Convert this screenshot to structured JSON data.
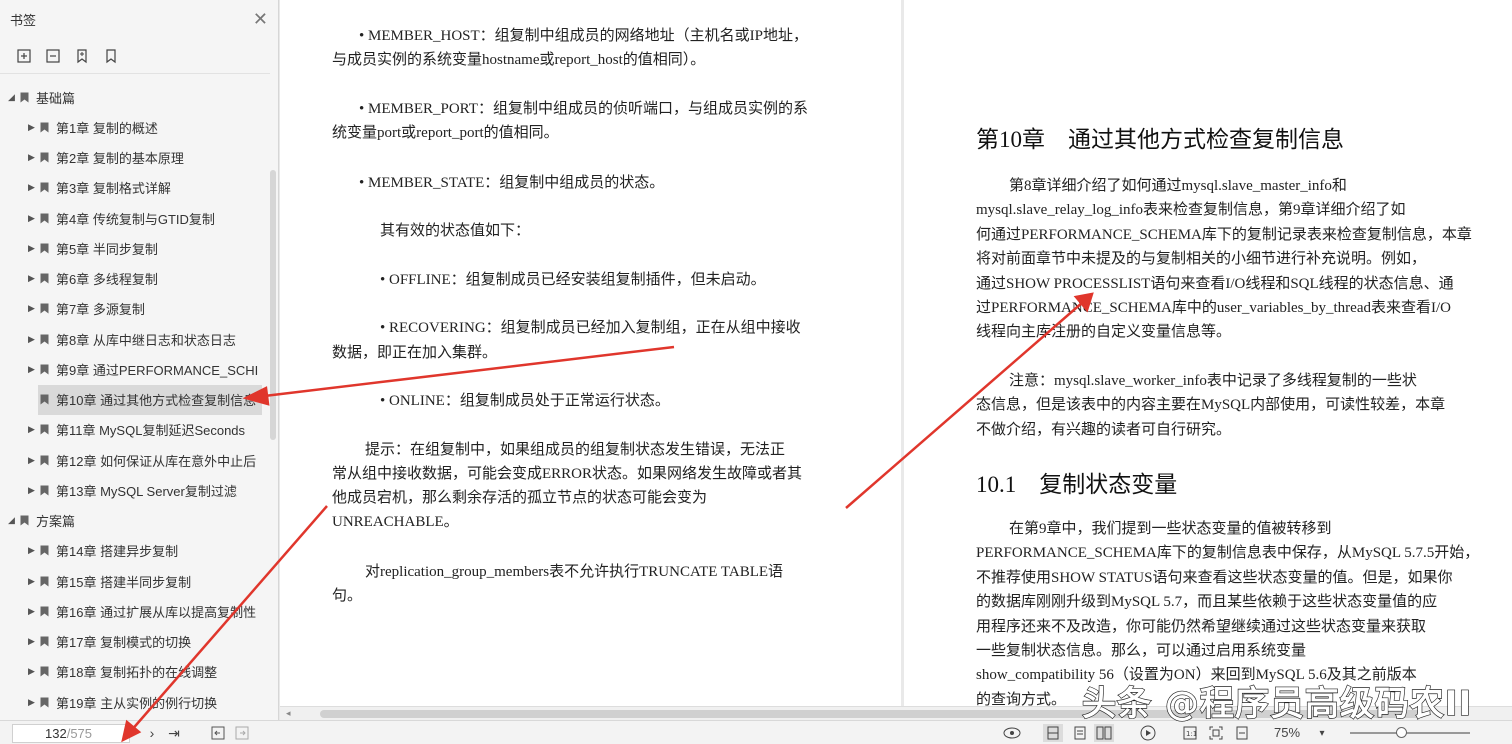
{
  "sidebar": {
    "title": "书签",
    "close_icon": "close-icon",
    "tools": [
      "expand-all-icon",
      "collapse-all-icon",
      "add-bookmark-icon",
      "bookmark-icon"
    ],
    "groups": [
      {
        "label": "基础篇",
        "items": [
          "第1章 复制的概述",
          "第2章 复制的基本原理",
          "第3章 复制格式详解",
          "第4章 传统复制与GTID复制",
          "第5章 半同步复制",
          "第6章 多线程复制",
          "第7章 多源复制",
          "第8章 从库中继日志和状态日志",
          "第9章 通过PERFORMANCE_SCHI",
          "第10章 通过其他方式检查复制信息",
          "第11章 MySQL复制延迟Seconds",
          "第12章 如何保证从库在意外中止后",
          "第13章 MySQL Server复制过滤"
        ]
      },
      {
        "label": "方案篇",
        "items": [
          "第14章 搭建异步复制",
          "第15章 搭建半同步复制",
          "第16章 通过扩展从库以提高复制性",
          "第17章 复制模式的切换",
          "第18章 复制拓扑的在线调整",
          "第19章 主从实例的例行切换"
        ]
      }
    ],
    "selected_item": "第10章 通过其他方式检查复制信息"
  },
  "left_page": {
    "paragraphs": [
      "• MEMBER_HOST：组复制中组成员的网络地址（主机名或IP地址，",
      "与成员实例的系统变量hostname或report_host的值相同）。",
      "• MEMBER_PORT：组复制中组成员的侦听端口，与组成员实例的系",
      "统变量port或report_port的值相同。",
      "• MEMBER_STATE：组复制中组成员的状态。",
      "其有效的状态值如下：",
      "• OFFLINE：组复制成员已经安装组复制插件，但未启动。",
      "• RECOVERING：组复制成员已经加入复制组，正在从组中接收",
      "数据，即正在加入集群。",
      "• ONLINE：组复制成员处于正常运行状态。",
      "提示：在组复制中，如果组成员的组复制状态发生错误，无法正",
      "常从组中接收数据，可能会变成ERROR状态。如果网络发生故障或者其",
      "他成员宕机，那么剩余存活的孤立节点的状态可能会变为",
      "UNREACHABLE。",
      "对replication_group_members表不允许执行TRUNCATE TABLE语",
      "句。"
    ]
  },
  "right_page": {
    "chapter_title": "第10章　通过其他方式检查复制信息",
    "intro": [
      "第8章详细介绍了如何通过mysql.slave_master_info和",
      "mysql.slave_relay_log_info表来检查复制信息，第9章详细介绍了如",
      "何通过PERFORMANCE_SCHEMA库下的复制记录表来检查复制信息，本章",
      "将对前面章节中未提及的与复制相关的小细节进行补充说明。例如，",
      "通过SHOW PROCESSLIST语句来查看I/O线程和SQL线程的状态信息、通",
      "过PERFORMANCE_SCHEMA库中的user_variables_by_thread表来查看I/O",
      "线程向主库注册的自定义变量信息等。"
    ],
    "note": [
      "注意：mysql.slave_worker_info表中记录了多线程复制的一些状",
      "态信息，但是该表中的内容主要在MySQL内部使用，可读性较差，本章",
      "不做介绍，有兴趣的读者可自行研究。"
    ],
    "section_title": "10.1　复制状态变量",
    "section_body": [
      "在第9章中，我们提到一些状态变量的值被转移到",
      "PERFORMANCE_SCHEMA库下的复制信息表中保存，从MySQL 5.7.5开始，",
      "不推荐使用SHOW STATUS语句来查看这些状态变量的值。但是，如果你",
      "的数据库刚刚升级到MySQL 5.7，而且某些依赖于这些状态变量值的应",
      "用程序还来不及改造，你可能仍然希望继续通过这些状态变量来获取",
      "一些复制状态信息。那么，可以通过启用系统变量",
      "show_compatibility 56（设置为ON）来回到MySQL 5.6及其之前版本",
      "的查询方式。"
    ]
  },
  "statusbar": {
    "current_page": "132",
    "total_pages": "/575",
    "zoom": "75%",
    "watermark": "头条 @程序员高级码农II"
  },
  "colors": {
    "annotation_arrow": "#e0362c",
    "selected_bg": "#d9d9d9"
  }
}
